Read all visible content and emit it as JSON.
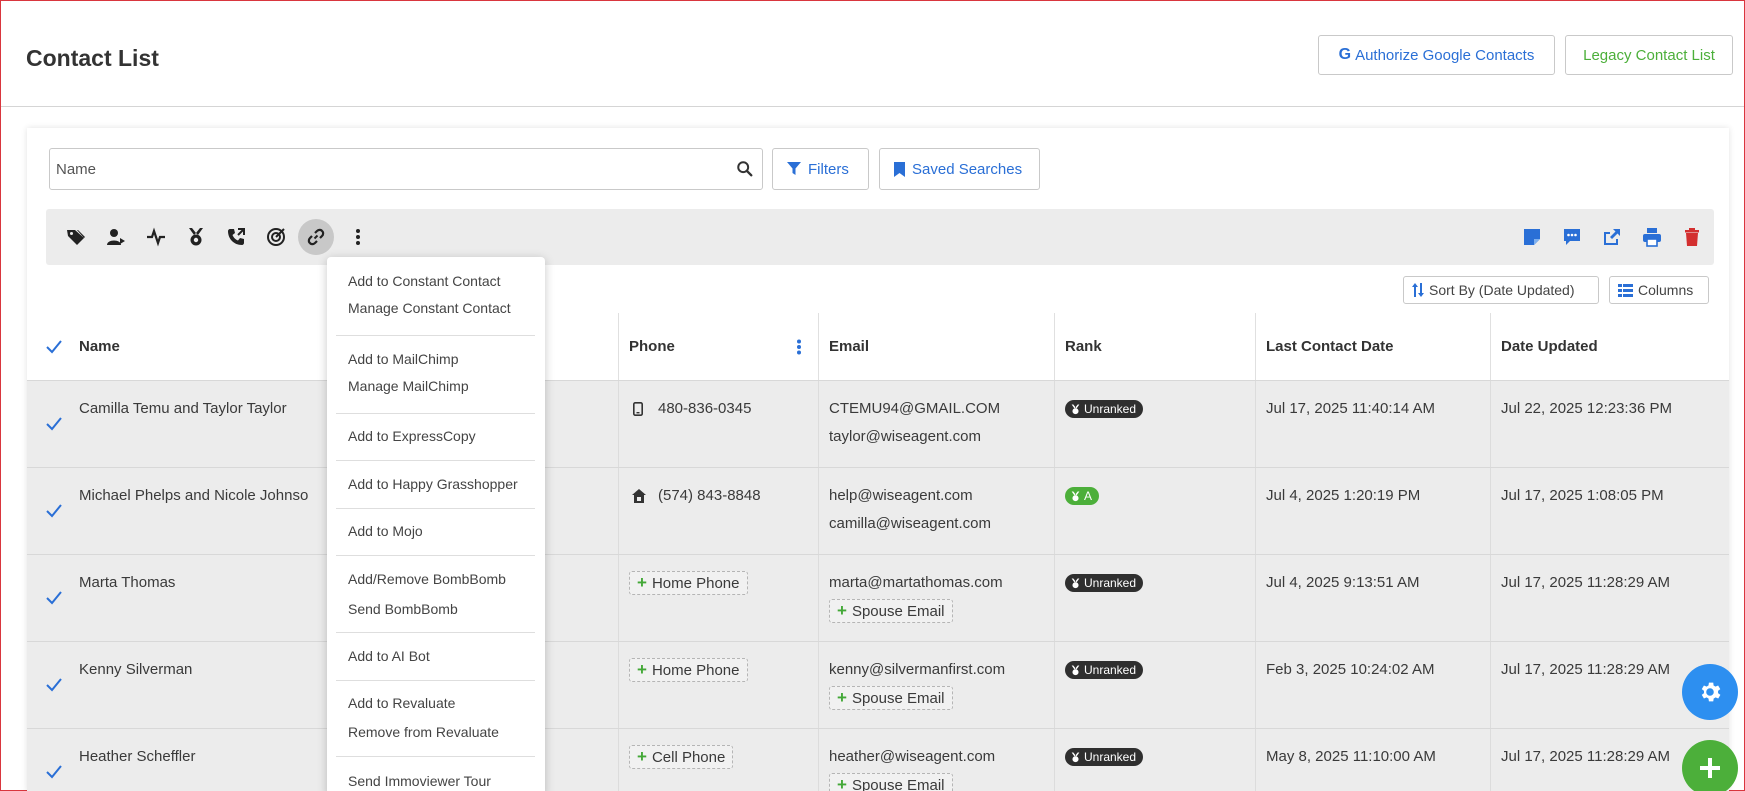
{
  "header": {
    "title": "Contact List",
    "google_button": "Authorize Google Contacts",
    "legacy_button": "Legacy Contact List"
  },
  "search": {
    "placeholder": "Name",
    "filters_label": "Filters",
    "saved_label": "Saved Searches"
  },
  "toolbar": {
    "left_icons": [
      "tag-icon",
      "user-assign-icon",
      "activity-icon",
      "rank-medal-icon",
      "phone-call-icon",
      "target-icon",
      "link-icon",
      "more-vertical-icon"
    ],
    "right_icons": [
      "note-icon",
      "message-icon",
      "share-icon",
      "print-icon",
      "trash-icon"
    ]
  },
  "sort_label": "Sort By (Date Updated)",
  "columns_label": "Columns",
  "table": {
    "headers": {
      "name": "Name",
      "phone": "Phone",
      "email": "Email",
      "rank": "Rank",
      "last_contact": "Last Contact Date",
      "date_updated": "Date Updated"
    },
    "rows": [
      {
        "name": "Camilla Temu and Taylor Taylor",
        "phone": "480-836-0345",
        "phone_type": "mobile",
        "email1": "CTEMU94@GMAIL.COM",
        "email2": "taylor@wiseagent.com",
        "rank": "Unranked",
        "last_contact": "Jul 17, 2025 11:40:14 AM",
        "date_updated": "Jul 22, 2025 12:23:36 PM"
      },
      {
        "name": "Michael Phelps and Nicole Johnso",
        "phone": "(574) 843-8848",
        "phone_type": "home",
        "email1": "help@wiseagent.com",
        "email2": "camilla@wiseagent.com",
        "rank": "A",
        "last_contact": "Jul 4, 2025 1:20:19 PM",
        "date_updated": "Jul 17, 2025 1:08:05 PM"
      },
      {
        "name": "Marta Thomas",
        "phone_add": "Home Phone",
        "email1": "marta@martathomas.com",
        "email_add": "Spouse Email",
        "rank": "Unranked",
        "last_contact": "Jul 4, 2025 9:13:51 AM",
        "date_updated": "Jul 17, 2025 11:28:29 AM"
      },
      {
        "name": "Kenny Silverman",
        "phone_add": "Home Phone",
        "email1": "kenny@silvermanfirst.com",
        "email_add": "Spouse Email",
        "rank": "Unranked",
        "last_contact": "Feb 3, 2025 10:24:02 AM",
        "date_updated": "Jul 17, 2025 11:28:29 AM"
      },
      {
        "name": "Heather Scheffler",
        "phone_add": "Cell Phone",
        "email1": "heather@wiseagent.com",
        "email_add": "Spouse Email",
        "rank": "Unranked",
        "last_contact": "May 8, 2025 11:10:00 AM",
        "date_updated": "Jul 17, 2025 11:28:29 AM"
      }
    ]
  },
  "menu": {
    "items": [
      "Add to Constant Contact",
      "Manage Constant Contact",
      "Add to MailChimp",
      "Manage MailChimp",
      "Add to ExpressCopy",
      "Add to Happy Grasshopper",
      "Add to Mojo",
      "Add/Remove BombBomb",
      "Send BombBomb",
      "Add to AI Bot",
      "Add to Revaluate",
      "Remove from Revaluate",
      "Send Immoviewer Tour"
    ]
  },
  "colors": {
    "accent_blue": "#2a6fd6",
    "accent_green": "#4caf3a",
    "danger_red": "#d32f2f"
  }
}
